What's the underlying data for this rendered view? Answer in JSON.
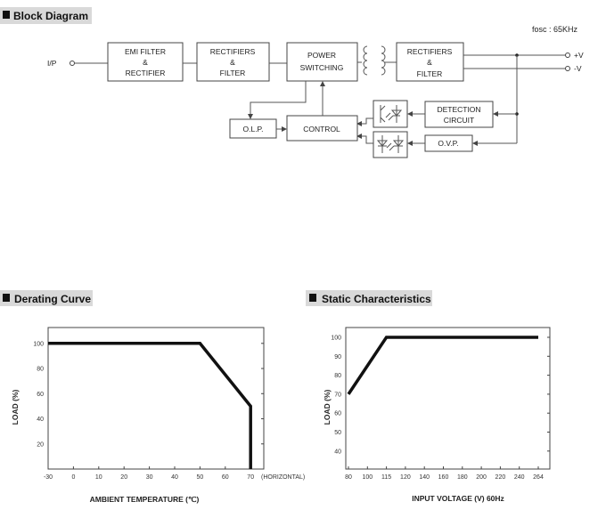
{
  "block_diagram": {
    "heading": "Block Diagram",
    "fosc": "fosc : 65KHz",
    "input_label": "I/P",
    "outputs": [
      "+V",
      "-V"
    ],
    "blocks": {
      "emi": [
        "EMI FILTER",
        "&",
        "RECTIFIER"
      ],
      "rect1": [
        "RECTIFIERS",
        "&",
        "FILTER"
      ],
      "power": [
        "POWER",
        "SWITCHING"
      ],
      "rect2": [
        "RECTIFIERS",
        "&",
        "FILTER"
      ],
      "detection": [
        "DETECTION",
        "CIRCUIT"
      ],
      "olp": "O.L.P.",
      "control": "CONTROL",
      "ovp": "O.V.P."
    }
  },
  "chart_data": [
    {
      "type": "line",
      "title": "Derating Curve",
      "xlabel": "AMBIENT TEMPERATURE (℃)",
      "ylabel": "LOAD (%)",
      "x_ticks": [
        "-30",
        "0",
        "10",
        "20",
        "30",
        "40",
        "50",
        "60",
        "70"
      ],
      "x_note": "(HORIZONTAL)",
      "y_ticks": [
        "20",
        "40",
        "60",
        "80",
        "100"
      ],
      "ylim": [
        0,
        100
      ],
      "points": [
        [
          -30,
          100
        ],
        [
          50,
          100
        ],
        [
          70,
          50
        ],
        [
          70,
          0
        ]
      ],
      "grid": false,
      "line_color": "#111111"
    },
    {
      "type": "line",
      "title": "Static Characteristics",
      "xlabel": "INPUT VOLTAGE (V) 60Hz",
      "ylabel": "LOAD (%)",
      "x_ticks": [
        "80",
        "100",
        "115",
        "120",
        "140",
        "160",
        "180",
        "200",
        "220",
        "240",
        "264"
      ],
      "y_ticks": [
        "40",
        "50",
        "60",
        "70",
        "80",
        "90",
        "100"
      ],
      "ylim": [
        30,
        100
      ],
      "points": [
        [
          80,
          70
        ],
        [
          115,
          100
        ],
        [
          264,
          100
        ]
      ],
      "grid": false,
      "line_color": "#111111"
    }
  ]
}
